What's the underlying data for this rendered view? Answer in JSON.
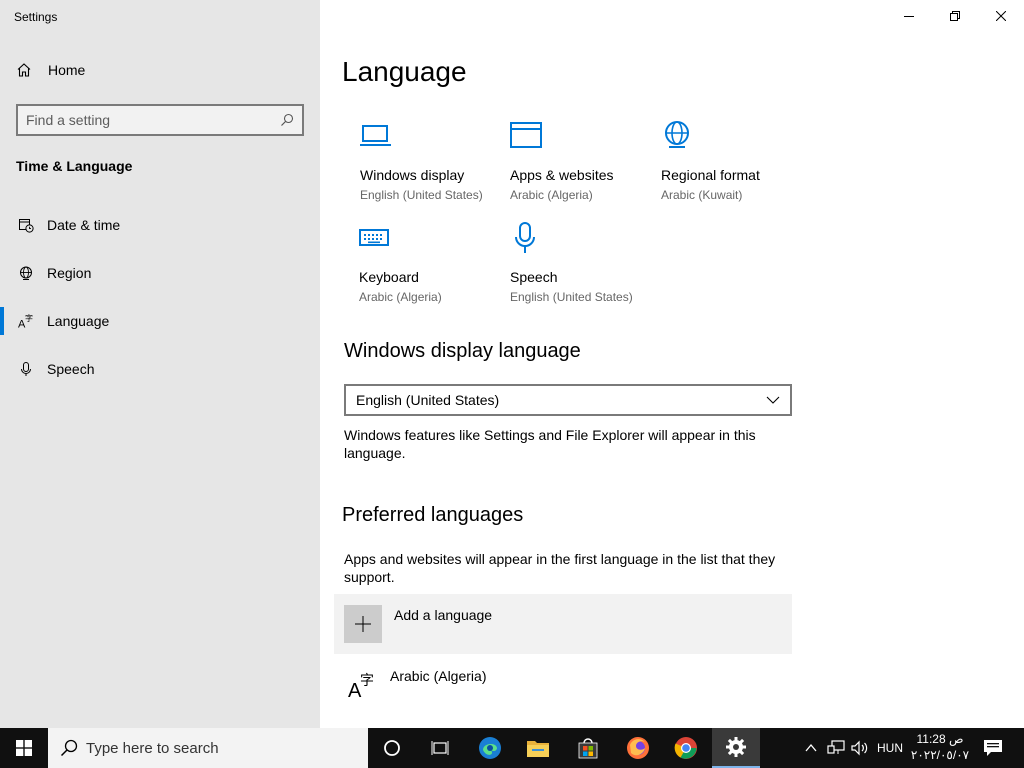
{
  "app": {
    "title": "Settings"
  },
  "sidebar": {
    "home_label": "Home",
    "search_placeholder": "Find a setting",
    "section_title": "Time & Language",
    "items": [
      {
        "label": "Date & time",
        "icon": "calendar-clock-icon"
      },
      {
        "label": "Region",
        "icon": "globe-icon"
      },
      {
        "label": "Language",
        "icon": "language-icon",
        "active": true
      },
      {
        "label": "Speech",
        "icon": "microphone-icon"
      }
    ]
  },
  "main": {
    "title": "Language",
    "tiles": [
      {
        "name": "Windows display",
        "sub": "English (United States)",
        "icon": "monitor-icon"
      },
      {
        "name": "Apps & websites",
        "sub": "Arabic (Algeria)",
        "icon": "browser-window-icon"
      },
      {
        "name": "Regional format",
        "sub": "Arabic (Kuwait)",
        "icon": "globe-format-icon"
      },
      {
        "name": "Keyboard",
        "sub": "Arabic (Algeria)",
        "icon": "keyboard-icon"
      },
      {
        "name": "Speech",
        "sub": "English (United States)",
        "icon": "microphone-icon"
      }
    ],
    "display_language": {
      "heading": "Windows display language",
      "selected": "English (United States)",
      "description": "Windows features like Settings and File Explorer will appear in this language."
    },
    "preferred": {
      "heading": "Preferred languages",
      "description": "Apps and websites will appear in the first language in the list that they support.",
      "add_label": "Add a language",
      "languages": [
        "Arabic (Algeria)"
      ]
    }
  },
  "taskbar": {
    "search_placeholder": "Type here to search",
    "input_indicator": "HUN",
    "time": "11:28 ص",
    "date": "٢٠٢٢/٠٥/٠٧"
  },
  "colors": {
    "accent": "#0078d7",
    "sidebar_bg": "#e6e6e6",
    "taskbar_bg": "#101010"
  }
}
